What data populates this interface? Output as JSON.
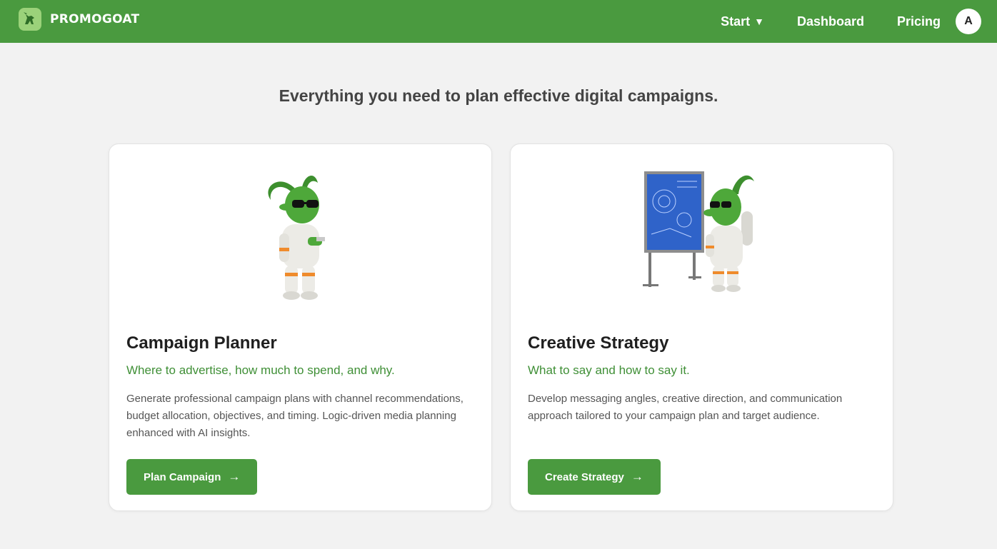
{
  "brand": {
    "name": "PROMOGOAT",
    "colors": {
      "primary": "#4a9a3f",
      "accent_text": "#3f8f36"
    }
  },
  "nav": {
    "start_label": "Start",
    "start_caret": "▼",
    "dashboard_label": "Dashboard",
    "pricing_label": "Pricing",
    "avatar_initial": "A"
  },
  "hero": {
    "text": "Everything you need to plan effective digital campaigns."
  },
  "cards": [
    {
      "illustration": "goat-astronaut-with-notepad",
      "title": "Campaign Planner",
      "subtitle": "Where to advertise, how much to spend, and why.",
      "description": "Generate professional campaign plans with channel recommendations, budget allocation, objectives, and timing. Logic-driven media planning enhanced with AI insights.",
      "button_label": "Plan Campaign",
      "button_icon": "arrow-right-icon"
    },
    {
      "illustration": "goat-astronaut-at-blueprint-board",
      "title": "Creative Strategy",
      "subtitle": "What to say and how to say it.",
      "description": "Develop messaging angles, creative direction, and communication approach tailored to your campaign plan and target audience.",
      "button_label": "Create Strategy",
      "button_icon": "arrow-right-icon"
    }
  ]
}
